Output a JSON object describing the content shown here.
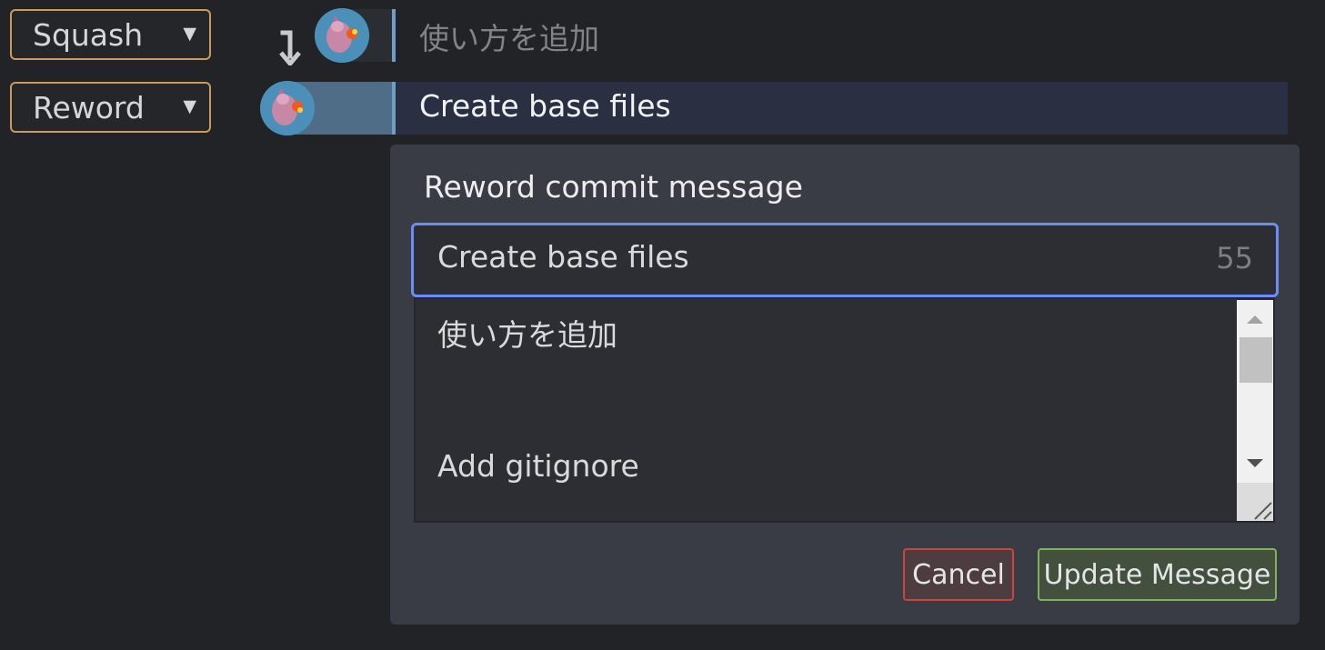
{
  "commits": [
    {
      "action": "Squash",
      "message": "使い方を追加"
    },
    {
      "action": "Reword",
      "message": "Create base files"
    }
  ],
  "reword": {
    "title": "Reword commit message",
    "summary_value": "Create base files",
    "char_count": "55",
    "body_lines": [
      "使い方を追加",
      "Add gitignore"
    ],
    "cancel_label": "Cancel",
    "update_label": "Update Message"
  },
  "colors": {
    "background": "#222326",
    "action_border": "#c99a5b",
    "focus_border": "#6b8ef5",
    "cancel_border": "#c9463f",
    "update_border": "#7fb35a",
    "row_highlight": "#2a3041"
  },
  "icons": {
    "caret": "caret-down-icon",
    "squash_arrow": "squash-arrow-icon",
    "avatar": "avatar",
    "scroll_up": "scroll-up-icon",
    "scroll_down": "scroll-down-icon",
    "resize": "resize-grip-icon"
  }
}
